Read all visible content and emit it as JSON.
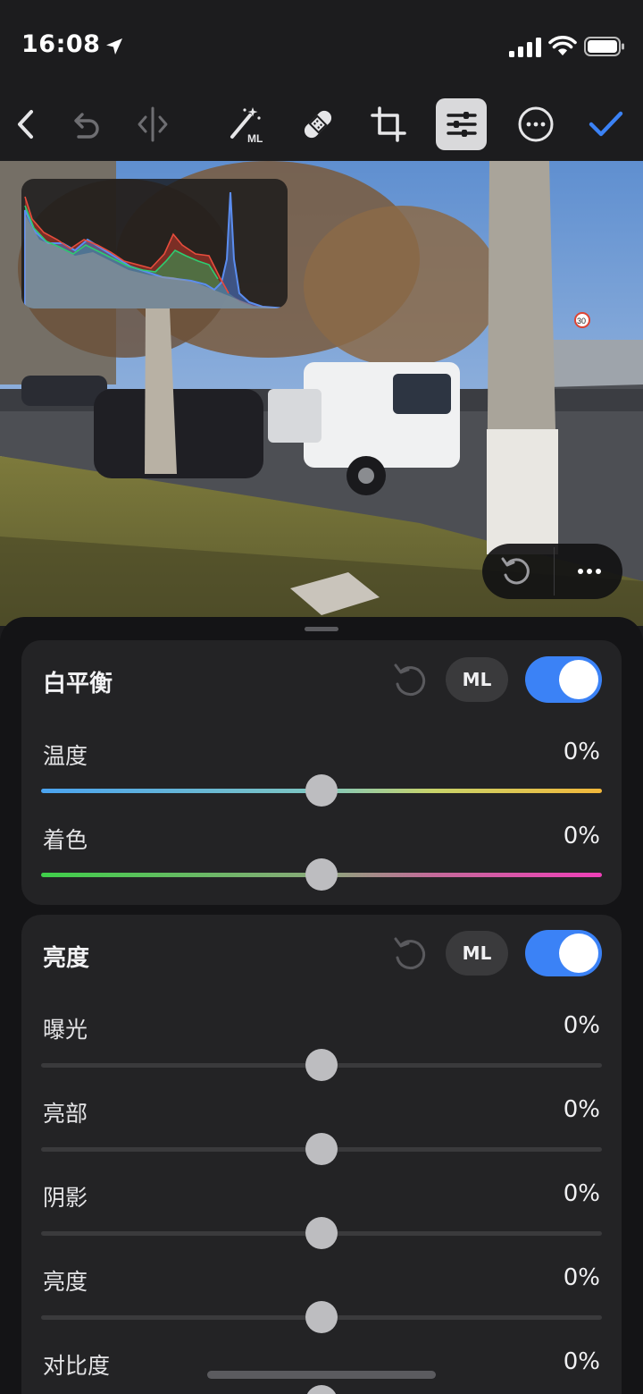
{
  "status_bar": {
    "time": "16:08"
  },
  "toolbar": {
    "icons": [
      "back-icon",
      "undo-icon",
      "compare-icon",
      "ml-magic-wand-icon",
      "bandage-icon",
      "crop-icon",
      "adjust-sliders-icon",
      "more-icon",
      "checkmark-icon"
    ],
    "ml_badge": "ML",
    "accent": "#3b82f6"
  },
  "photo": {
    "signs": [
      "30"
    ]
  },
  "panel": {
    "white_balance": {
      "title": "白平衡",
      "ml_label": "ML",
      "enabled": true,
      "sliders": [
        {
          "label": "温度",
          "value": "0%",
          "level": 0
        },
        {
          "label": "着色",
          "value": "0%",
          "level": 0
        }
      ]
    },
    "light": {
      "title": "亮度",
      "ml_label": "ML",
      "enabled": true,
      "sliders": [
        {
          "label": "曝光",
          "value": "0%",
          "level": 0
        },
        {
          "label": "亮部",
          "value": "0%",
          "level": 0
        },
        {
          "label": "阴影",
          "value": "0%",
          "level": 0
        },
        {
          "label": "亮度",
          "value": "0%",
          "level": 0
        },
        {
          "label": "对比度",
          "value": "0%",
          "level": 0
        }
      ]
    }
  }
}
